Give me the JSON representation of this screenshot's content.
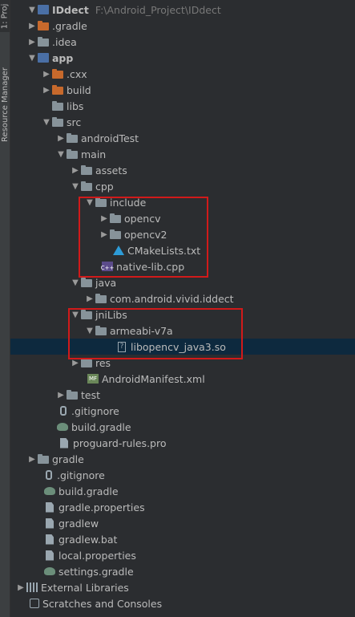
{
  "side_tabs": {
    "project": "1: Proj",
    "resource_manager": "Resource Manager"
  },
  "colors": {
    "background": "#2b2d30",
    "selection": "#0d293e",
    "highlight_box": "#d11a1a",
    "text": "#bbbbbb"
  },
  "tree": [
    {
      "label": "IDdect",
      "path": "F:\\Android_Project\\IDdect",
      "arrow": "down",
      "icon": "module",
      "bold": true
    },
    {
      "label": ".gradle",
      "arrow": "right",
      "icon": "folder-orange"
    },
    {
      "label": ".idea",
      "arrow": "right",
      "icon": "folder"
    },
    {
      "label": "app",
      "arrow": "down",
      "icon": "module",
      "bold": true
    },
    {
      "label": ".cxx",
      "arrow": "right",
      "icon": "folder-orange"
    },
    {
      "label": "build",
      "arrow": "right",
      "icon": "folder-orange"
    },
    {
      "label": "libs",
      "arrow": "",
      "icon": "folder"
    },
    {
      "label": "src",
      "arrow": "down",
      "icon": "folder"
    },
    {
      "label": "androidTest",
      "arrow": "right",
      "icon": "folder"
    },
    {
      "label": "main",
      "arrow": "down",
      "icon": "folder"
    },
    {
      "label": "assets",
      "arrow": "right",
      "icon": "folder"
    },
    {
      "label": "cpp",
      "arrow": "down",
      "icon": "folder"
    },
    {
      "label": "include",
      "arrow": "down",
      "icon": "folder"
    },
    {
      "label": "opencv",
      "arrow": "right",
      "icon": "folder"
    },
    {
      "label": "opencv2",
      "arrow": "right",
      "icon": "folder"
    },
    {
      "label": "CMakeLists.txt",
      "arrow": "",
      "icon": "cmake"
    },
    {
      "label": "native-lib.cpp",
      "arrow": "",
      "icon": "cpp"
    },
    {
      "label": "java",
      "arrow": "down",
      "icon": "folder"
    },
    {
      "label": "com.android.vivid.iddect",
      "arrow": "right",
      "icon": "folder"
    },
    {
      "label": "jniLibs",
      "arrow": "down",
      "icon": "folder"
    },
    {
      "label": "armeabi-v7a",
      "arrow": "down",
      "icon": "folder"
    },
    {
      "label": "libopencv_java3.so",
      "arrow": "",
      "icon": "so",
      "selected": true
    },
    {
      "label": "res",
      "arrow": "right",
      "icon": "folder"
    },
    {
      "label": "AndroidManifest.xml",
      "arrow": "",
      "icon": "xml"
    },
    {
      "label": "test",
      "arrow": "right",
      "icon": "folder"
    },
    {
      "label": ".gitignore",
      "arrow": "",
      "icon": "git"
    },
    {
      "label": "build.gradle",
      "arrow": "",
      "icon": "gradle"
    },
    {
      "label": "proguard-rules.pro",
      "arrow": "",
      "icon": "txt"
    },
    {
      "label": "gradle",
      "arrow": "right",
      "icon": "folder"
    },
    {
      "label": ".gitignore",
      "arrow": "",
      "icon": "git"
    },
    {
      "label": "build.gradle",
      "arrow": "",
      "icon": "gradle"
    },
    {
      "label": "gradle.properties",
      "arrow": "",
      "icon": "txt"
    },
    {
      "label": "gradlew",
      "arrow": "",
      "icon": "txt"
    },
    {
      "label": "gradlew.bat",
      "arrow": "",
      "icon": "txt"
    },
    {
      "label": "local.properties",
      "arrow": "",
      "icon": "txt"
    },
    {
      "label": "settings.gradle",
      "arrow": "",
      "icon": "gradle"
    },
    {
      "label": "External Libraries",
      "arrow": "right",
      "icon": "lib"
    },
    {
      "label": "Scratches and Consoles",
      "arrow": "",
      "icon": "scratch"
    }
  ]
}
